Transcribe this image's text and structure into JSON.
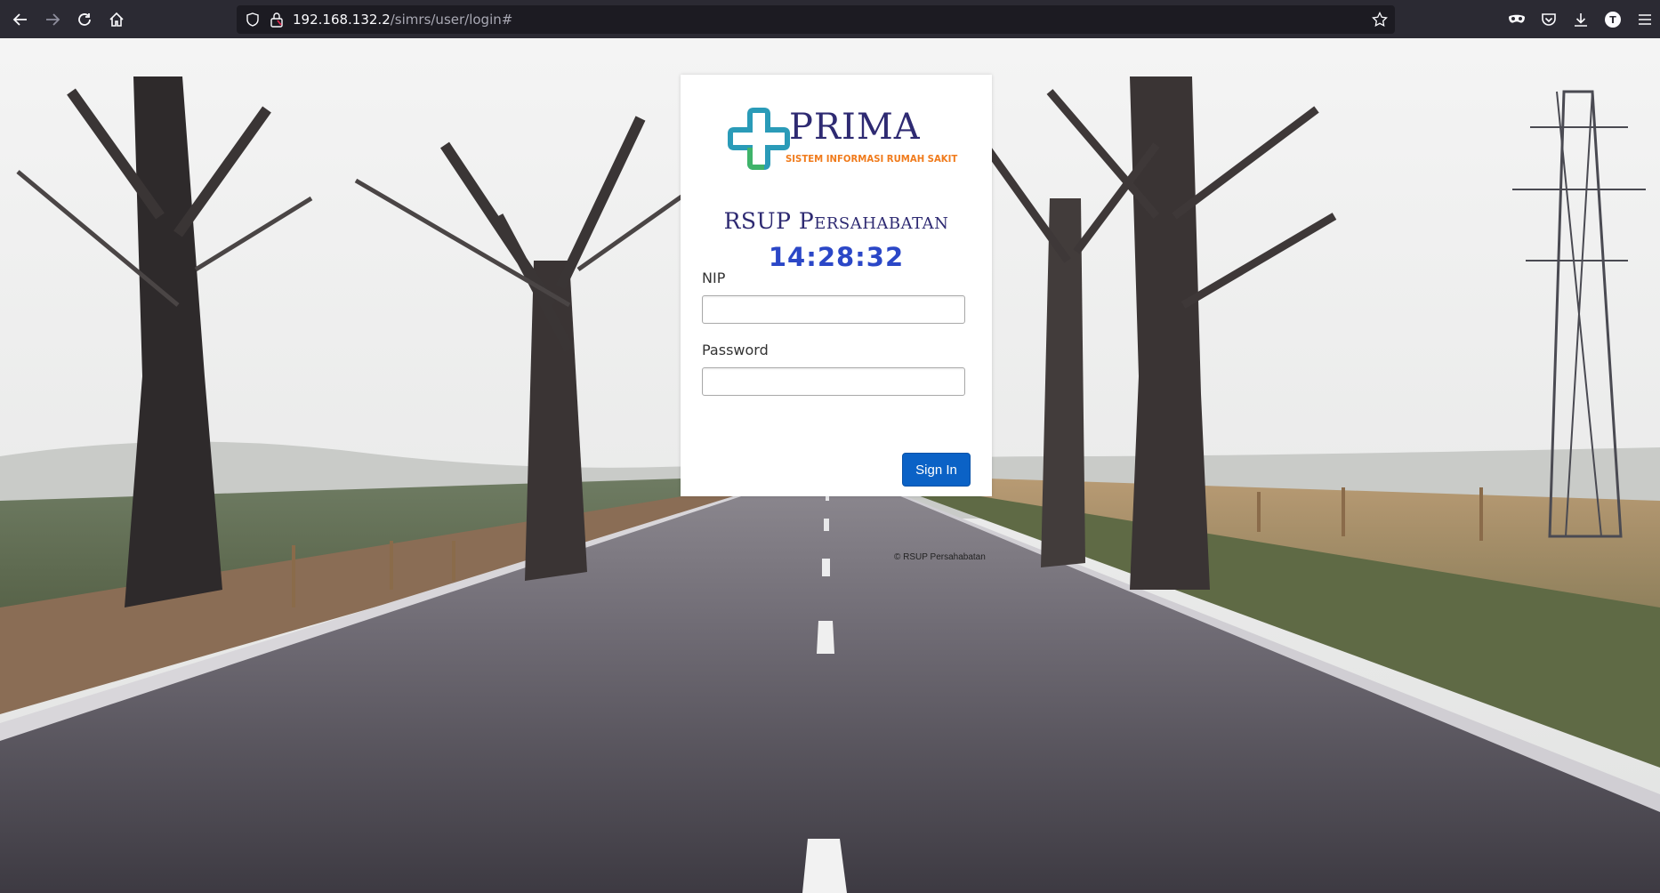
{
  "browser": {
    "url_host": "192.168.132.2",
    "url_path": "/simrs/user/login#",
    "profile_initial": "T",
    "icons": {
      "back": "back-arrow-icon",
      "forward": "forward-arrow-icon",
      "reload": "reload-icon",
      "home": "home-icon",
      "tracking": "shield-icon",
      "lock": "lock-icon",
      "bookmark": "star-icon",
      "private": "mask-icon",
      "pocket": "pocket-icon",
      "downloads": "download-icon",
      "menu": "hamburger-menu-icon"
    }
  },
  "logo": {
    "title": "PRIMA",
    "subtitle": "SISTEM INFORMASI RUMAH SAKIT"
  },
  "login": {
    "hospital_name": "RSUP Persahabatan",
    "clock": "14:28:32",
    "nip_label": "NIP",
    "nip_value": "",
    "password_label": "Password",
    "password_value": "",
    "signin_label": "Sign In"
  },
  "footer": {
    "copyright": "© RSUP Persahabatan"
  },
  "colors": {
    "signin_button": "#0b62c6",
    "clock_text": "#2b47c7",
    "hospital_name_text": "#2e2a72",
    "logo_text": "#2e2a72",
    "logo_subtitle": "#f07b1c"
  }
}
